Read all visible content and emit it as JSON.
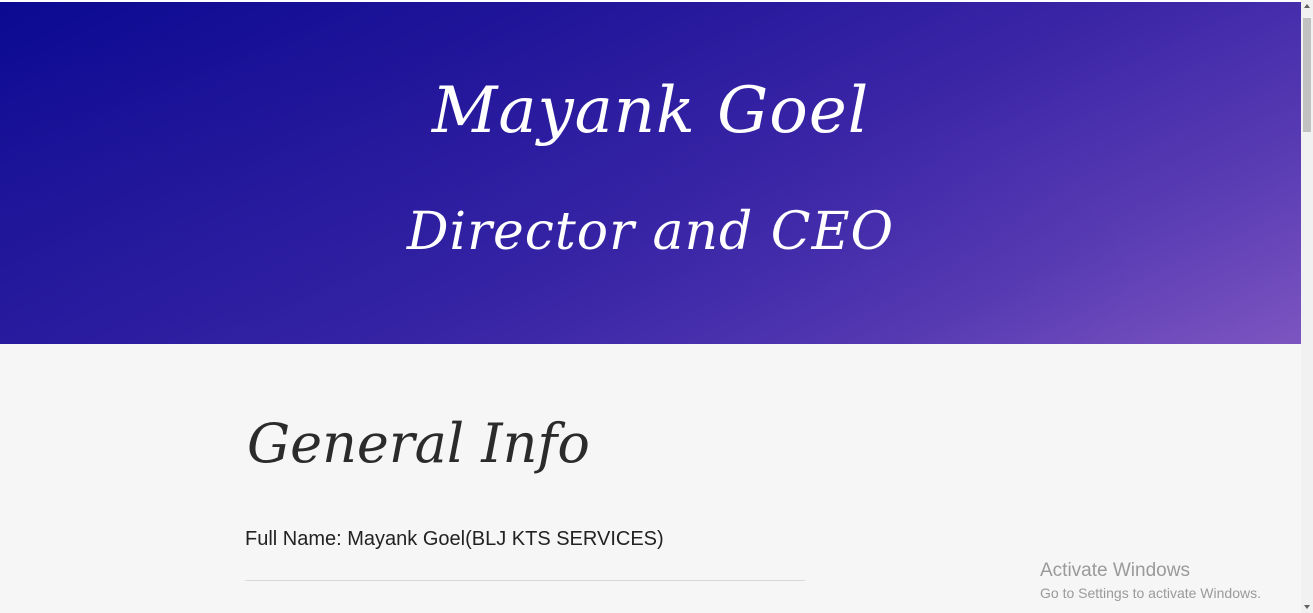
{
  "hero": {
    "name": "Mayank Goel",
    "title": "Director and CEO",
    "gradient_start": "#0b0a92",
    "gradient_end": "#7c55c0"
  },
  "general_info": {
    "heading": "General Info",
    "full_name_label": "Full Name: Mayank Goel(BLJ KTS SERVICES)"
  },
  "watermark": {
    "title": "Activate Windows",
    "subtitle": "Go to Settings to activate Windows."
  },
  "colors": {
    "background": "#f6f6f6",
    "text": "#222222",
    "watermark": "#9a9a9a"
  }
}
